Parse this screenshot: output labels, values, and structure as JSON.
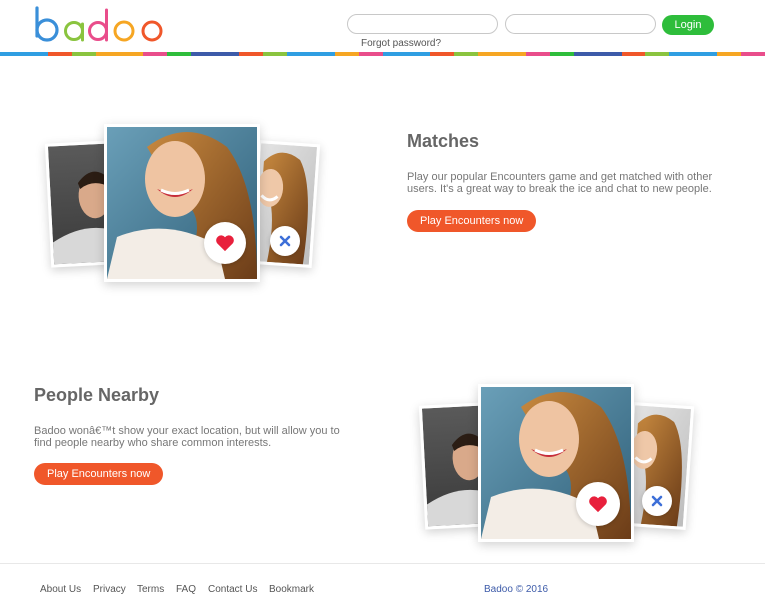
{
  "header": {
    "logo_text": "badoo",
    "email_value": "",
    "password_value": "",
    "login_label": "Login",
    "forgot_label": "Forgot password?",
    "stripe_colors": [
      "#2f9ee2",
      "#f0572a",
      "#8ac43f",
      "#f6a623",
      "#e94d8b",
      "#2ebd3b",
      "#3d5ba9",
      "#f0572a",
      "#8ac43f",
      "#2f9ee2",
      "#f6a623",
      "#e94d8b"
    ]
  },
  "matches": {
    "title": "Matches",
    "description_line1": "Play our popular Encounters game and get matched with other",
    "description_line2": "users. It's a great way to break the ice and chat to new people.",
    "cta_label": "Play Encounters now"
  },
  "nearby": {
    "title": "People Nearby",
    "description_line1": "Badoo wonâ€™t show your exact location, but will allow you to",
    "description_line2": "find people nearby who share common interests.",
    "cta_label": "Play Encounters now"
  },
  "icons": {
    "like": "heart-icon",
    "dislike": "close-icon"
  },
  "colors": {
    "accent": "#f0572a",
    "login": "#2ebd3b",
    "heart": "#e8203c",
    "cross": "#3d6fd8"
  },
  "footer": {
    "links": [
      "About Us",
      "Privacy",
      "Terms",
      "FAQ",
      "Contact Us",
      "Bookmark"
    ],
    "copyright": "Badoo © 2016"
  }
}
